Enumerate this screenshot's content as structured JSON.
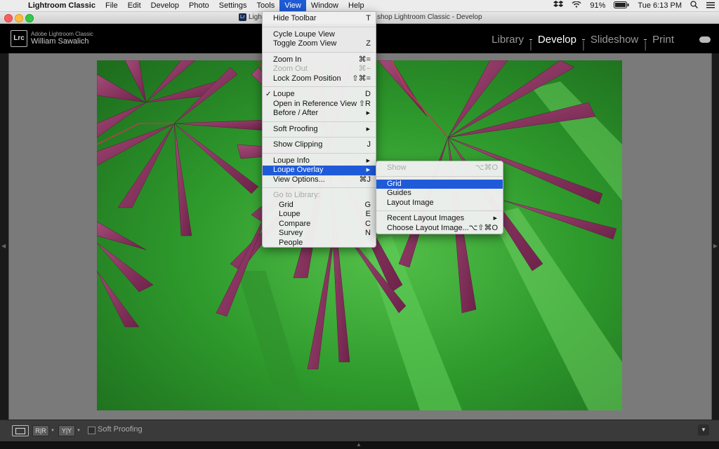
{
  "menubar": {
    "app": "Lightroom Classic",
    "items": [
      "File",
      "Edit",
      "Develop",
      "Photo",
      "Settings",
      "Tools",
      "View",
      "Window",
      "Help"
    ],
    "active_index": 6,
    "battery": "91%",
    "clock": "Tue 6:13 PM"
  },
  "window": {
    "title": "Adobe Photoshop Lightroom Classic - Develop",
    "title_visible_left": "Ligh",
    "title_visible_right": "shop Lightroom Classic - Develop"
  },
  "identity": {
    "logo": "Lrc",
    "product": "Adobe Lightroom Classic",
    "user": "William Sawalich"
  },
  "modules": {
    "items": [
      "Library",
      "Develop",
      "Slideshow",
      "Print"
    ],
    "active": "Develop"
  },
  "view_menu": {
    "hide_toolbar": {
      "label": "Hide Toolbar",
      "shortcut": "T"
    },
    "cycle_loupe": {
      "label": "Cycle Loupe View"
    },
    "toggle_zoom": {
      "label": "Toggle Zoom View",
      "shortcut": "Z"
    },
    "zoom_in": {
      "label": "Zoom In",
      "shortcut": "⌘="
    },
    "zoom_out": {
      "label": "Zoom Out",
      "shortcut": "⌘−"
    },
    "lock_zoom": {
      "label": "Lock Zoom Position",
      "shortcut": "⇧⌘="
    },
    "loupe": {
      "label": "Loupe",
      "shortcut": "D",
      "checked": "✓"
    },
    "reference": {
      "label": "Open in Reference View",
      "shortcut": "⇧R"
    },
    "before_after": {
      "label": "Before / After"
    },
    "soft_proofing": {
      "label": "Soft Proofing"
    },
    "show_clipping": {
      "label": "Show Clipping",
      "shortcut": "J"
    },
    "loupe_info": {
      "label": "Loupe Info"
    },
    "loupe_overlay": {
      "label": "Loupe Overlay"
    },
    "view_options": {
      "label": "View Options...",
      "shortcut": "⌘J"
    },
    "go_to_library": {
      "label": "Go to Library:"
    },
    "grid": {
      "label": "Grid",
      "shortcut": "G"
    },
    "loupe_lib": {
      "label": "Loupe",
      "shortcut": "E"
    },
    "compare": {
      "label": "Compare",
      "shortcut": "C"
    },
    "survey": {
      "label": "Survey",
      "shortcut": "N"
    },
    "people": {
      "label": "People"
    }
  },
  "overlay_menu": {
    "show": {
      "label": "Show",
      "shortcut": "⌥⌘O"
    },
    "grid": {
      "label": "Grid"
    },
    "guides": {
      "label": "Guides"
    },
    "layout_image": {
      "label": "Layout Image"
    },
    "recent_layout": {
      "label": "Recent Layout Images"
    },
    "choose_layout": {
      "label": "Choose Layout Image...",
      "shortcut": "⌥⇧⌘O"
    }
  },
  "toolbar": {
    "soft_proofing": "Soft Proofing",
    "view_mode_ab": "R|R",
    "view_mode_yy": "Y|Y"
  },
  "colors": {
    "accent": "#1f5ad9",
    "menubar": "#ececec",
    "leaf": "#8a2f5e",
    "background_green": "#3fa23a"
  },
  "icons": [
    "apple-icon",
    "dropbox-icon",
    "wifi-icon",
    "battery-icon",
    "search-icon",
    "list-icon",
    "cloud-icon",
    "checkmark-icon",
    "submenu-arrow-icon"
  ]
}
